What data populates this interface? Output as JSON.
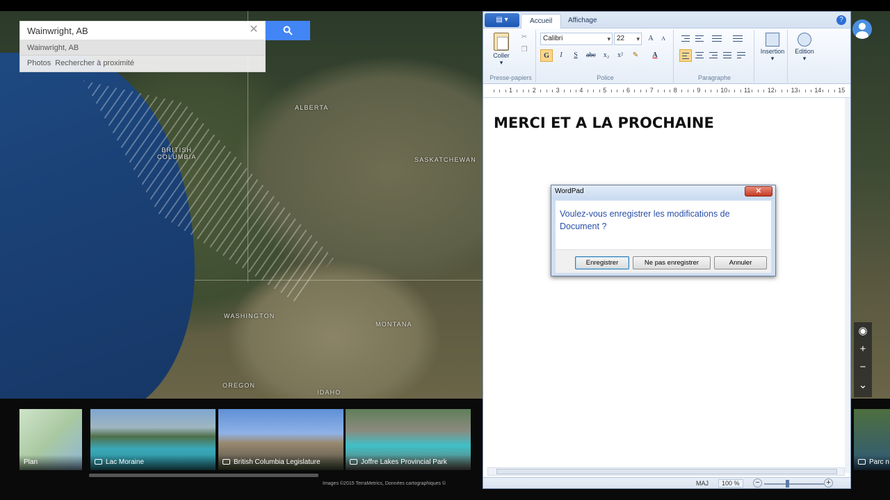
{
  "map": {
    "search": {
      "value": "Wainwright, AB"
    },
    "suggestions": {
      "first": "Wainwright, AB",
      "photos": "Photos",
      "nearby": "Rechercher à proximité"
    },
    "labels": {
      "alberta": "ALBERTA",
      "bc_line1": "BRITISH",
      "bc_line2": "COLUMBIA",
      "saskatchewan": "SASKATCHEWAN",
      "washington": "WASHINGTON",
      "montana": "MONTANA",
      "oregon": "OREGON",
      "idaho": "IDAHO"
    },
    "controls": {
      "compass": "◉",
      "zoom_in": "+",
      "zoom_out": "−",
      "expand": "⌄"
    }
  },
  "strip": {
    "thumbs": [
      {
        "caption": "Plan"
      },
      {
        "caption": "Lac Moraine"
      },
      {
        "caption": "British Columbia Legislature"
      },
      {
        "caption": "Joffre Lakes Provincial Park"
      },
      {
        "caption": "Parc n"
      }
    ],
    "credits": "Images ©2015 TerraMetrics, Données cartographiques ©"
  },
  "wordpad": {
    "tabs": {
      "home": "Accueil",
      "view": "Affichage"
    },
    "clipboard": {
      "paste": "Coller",
      "group_label": "Presse-papiers"
    },
    "font": {
      "name": "Calibri",
      "size": "22",
      "group_label": "Police",
      "grow": "A",
      "shrink": "A",
      "bold": "G",
      "italic": "I",
      "underline": "S",
      "strike": "abc",
      "subscript": "x₂",
      "superscript": "x²",
      "color": "A"
    },
    "paragraph": {
      "group_label": "Paragraphe"
    },
    "insert": {
      "label": "Insertion"
    },
    "edit": {
      "label": "Edition"
    },
    "ruler": [
      "1",
      "2",
      "3",
      "4",
      "5",
      "6",
      "7",
      "8",
      "9",
      "10",
      "11",
      "12",
      "13",
      "14",
      "15"
    ],
    "document": {
      "text": "MERCI ET A LA PROCHAINE"
    },
    "status": {
      "caps": "MAJ",
      "zoom": "100 %"
    }
  },
  "dialog": {
    "title": "WordPad",
    "message": "Voulez-vous enregistrer les modifications de Document ?",
    "buttons": {
      "save": "Enregistrer",
      "dont_save": "Ne pas enregistrer",
      "cancel": "Annuler"
    }
  }
}
